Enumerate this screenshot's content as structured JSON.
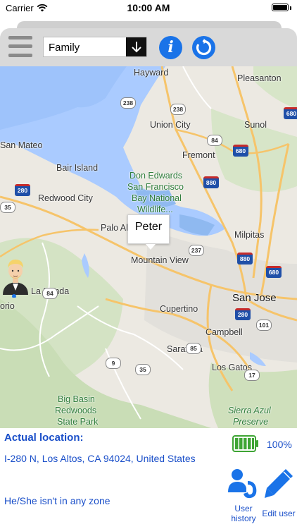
{
  "status_bar": {
    "carrier": "Carrier",
    "time": "10:00 AM",
    "battery_level": 1.0
  },
  "toolbar": {
    "group_selected": "Family",
    "info_label": "i"
  },
  "map": {
    "city_labels": {
      "hayward": "Hayward",
      "pleasanton": "Pleasanton",
      "union_city": "Union City",
      "sunol": "Sunol",
      "san_mateo": "San Mateo",
      "fremont": "Fremont",
      "bair_island": "Bair Island",
      "redwood_city": "Redwood City",
      "palo_alto": "Palo Alto",
      "milpitas": "Milpitas",
      "mountain_view": "Mountain View",
      "san_jose": "San Jose",
      "cupertino": "Cupertino",
      "la_honda": "La Honda",
      "campbell": "Campbell",
      "saratoga": "Saratoga",
      "los_gatos": "Los Gatos",
      "orio": "orio",
      "refuge_line1": "Don Edwards",
      "refuge_line2": "San Francisco",
      "refuge_line3": "Bay National",
      "refuge_line4": "Wildlife...",
      "big_basin_line1": "Big Basin",
      "big_basin_line2": "Redwoods",
      "big_basin_line3": "State Park",
      "sierra_azul_line1": "Sierra Azul",
      "sierra_azul_line2": "Preserve"
    },
    "shields": {
      "s238a": "238",
      "s238b": "238",
      "s84": "84",
      "s880a": "880",
      "s680a": "680",
      "s280a": "280",
      "s35a": "35",
      "s237": "237",
      "s880b": "880",
      "s680b": "680",
      "s84b": "84",
      "s280b": "280",
      "s101": "101",
      "s85": "85",
      "s9": "9",
      "s35b": "35",
      "s17": "17"
    },
    "person_callout": "Peter"
  },
  "info_panel": {
    "actual_location_label": "Actual location:",
    "address": "I-280 N, Los Altos, CA  94024, United States",
    "zone_status": "He/She isn't in any zone",
    "battery_percent": "100%",
    "user_history_label_1": "User",
    "user_history_label_2": "history",
    "edit_user_label": "Edit user"
  },
  "colors": {
    "accent_blue": "#1a4fc9",
    "button_blue": "#1a73e8",
    "battery_green": "#3fa535"
  }
}
